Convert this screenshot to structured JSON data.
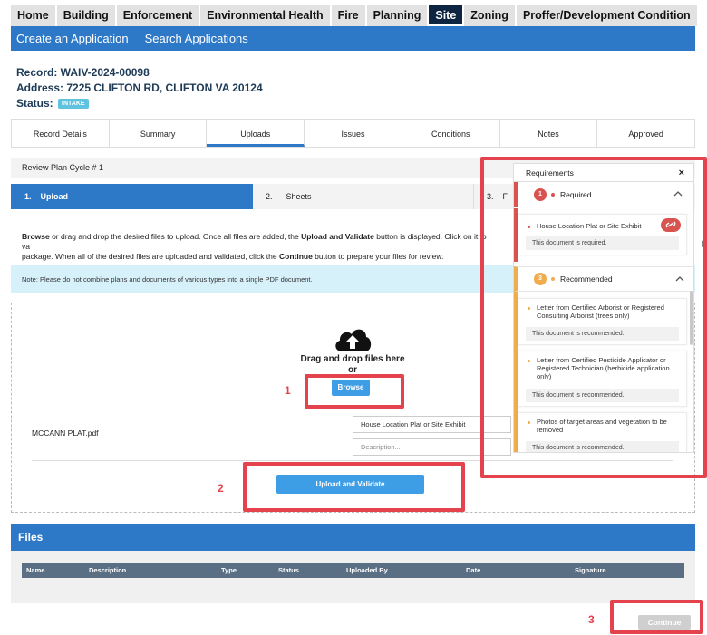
{
  "top_tabs": [
    {
      "label": "Home"
    },
    {
      "label": "Building"
    },
    {
      "label": "Enforcement"
    },
    {
      "label": "Environmental Health"
    },
    {
      "label": "Fire"
    },
    {
      "label": "Planning"
    },
    {
      "label": "Site"
    },
    {
      "label": "Zoning"
    },
    {
      "label": "Proffer/Development Condition"
    }
  ],
  "subnav": {
    "create": "Create an Application",
    "search": "Search Applications"
  },
  "record": {
    "record_line": "Record: WAIV-2024-00098",
    "address_line": "Address: 7225 CLIFTON RD, CLIFTON VA 20124",
    "status_label": "Status:",
    "status_badge": "INTAKE"
  },
  "record_tabs": [
    {
      "label": "Record Details"
    },
    {
      "label": "Summary"
    },
    {
      "label": "Uploads"
    },
    {
      "label": "Issues"
    },
    {
      "label": "Conditions"
    },
    {
      "label": "Notes"
    },
    {
      "label": "Approved"
    }
  ],
  "cycle": "Review Plan Cycle # 1",
  "steps": [
    {
      "num": "1.",
      "label": "Upload"
    },
    {
      "num": "2.",
      "label": "Sheets"
    },
    {
      "num": "3.",
      "label": "F"
    }
  ],
  "instructions": {
    "b1": "Browse",
    "t1": " or drag and drop the desired files to upload. Once all files are added, the ",
    "b2": "Upload and Validate",
    "t2": " button is displayed. Click on it to va",
    "t3": "package. When all of the desired files are uploaded and validated, click the ",
    "b3": "Continue",
    "t4": " button to prepare your files for review."
  },
  "note": "Note: Please do not combine plans and documents of various types into a single PDF document.",
  "dropzone": {
    "drag_text": "Drag and drop files here",
    "or_text": "or",
    "browse_label": "Browse"
  },
  "file": {
    "name": "MCCANN PLAT.pdf",
    "type_value": "House Location Plat or Site Exhibit",
    "description_placeholder": "Description..."
  },
  "upload_label": "Upload and Validate",
  "callouts": {
    "one": "1",
    "two": "2",
    "three": "3"
  },
  "files": {
    "heading": "Files",
    "columns": [
      "Name",
      "Description",
      "Type",
      "Status",
      "Uploaded By",
      "Date",
      "Signature"
    ]
  },
  "continue_label": "Continue",
  "requirements": {
    "title": "Requirements",
    "close": "×",
    "required_count": "1",
    "required_label": "Required",
    "required_items": [
      {
        "title": "House Location Plat or Site Exhibit",
        "status": "This document is required."
      }
    ],
    "recommended_count": "3",
    "recommended_label": "Recommended",
    "recommended_items": [
      {
        "title": "Letter from Certified Arborist or Registered Consulting Arborist (trees only)",
        "status": "This document is recommended."
      },
      {
        "title": "Letter from Certified Pesticide Applicator or Registered Technician (herbicide application only)",
        "status": "This document is recommended."
      },
      {
        "title": "Photos of target areas and vegetation to be removed",
        "status": "This document is recommended."
      }
    ]
  },
  "colors": {
    "nav_blue": "#2d78c7",
    "active_tab": "#0d2540",
    "badge": "#5fc2de",
    "required_red": "#d9534f",
    "recommended_orange": "#f0ad4e",
    "highlight": "#e4424d"
  }
}
